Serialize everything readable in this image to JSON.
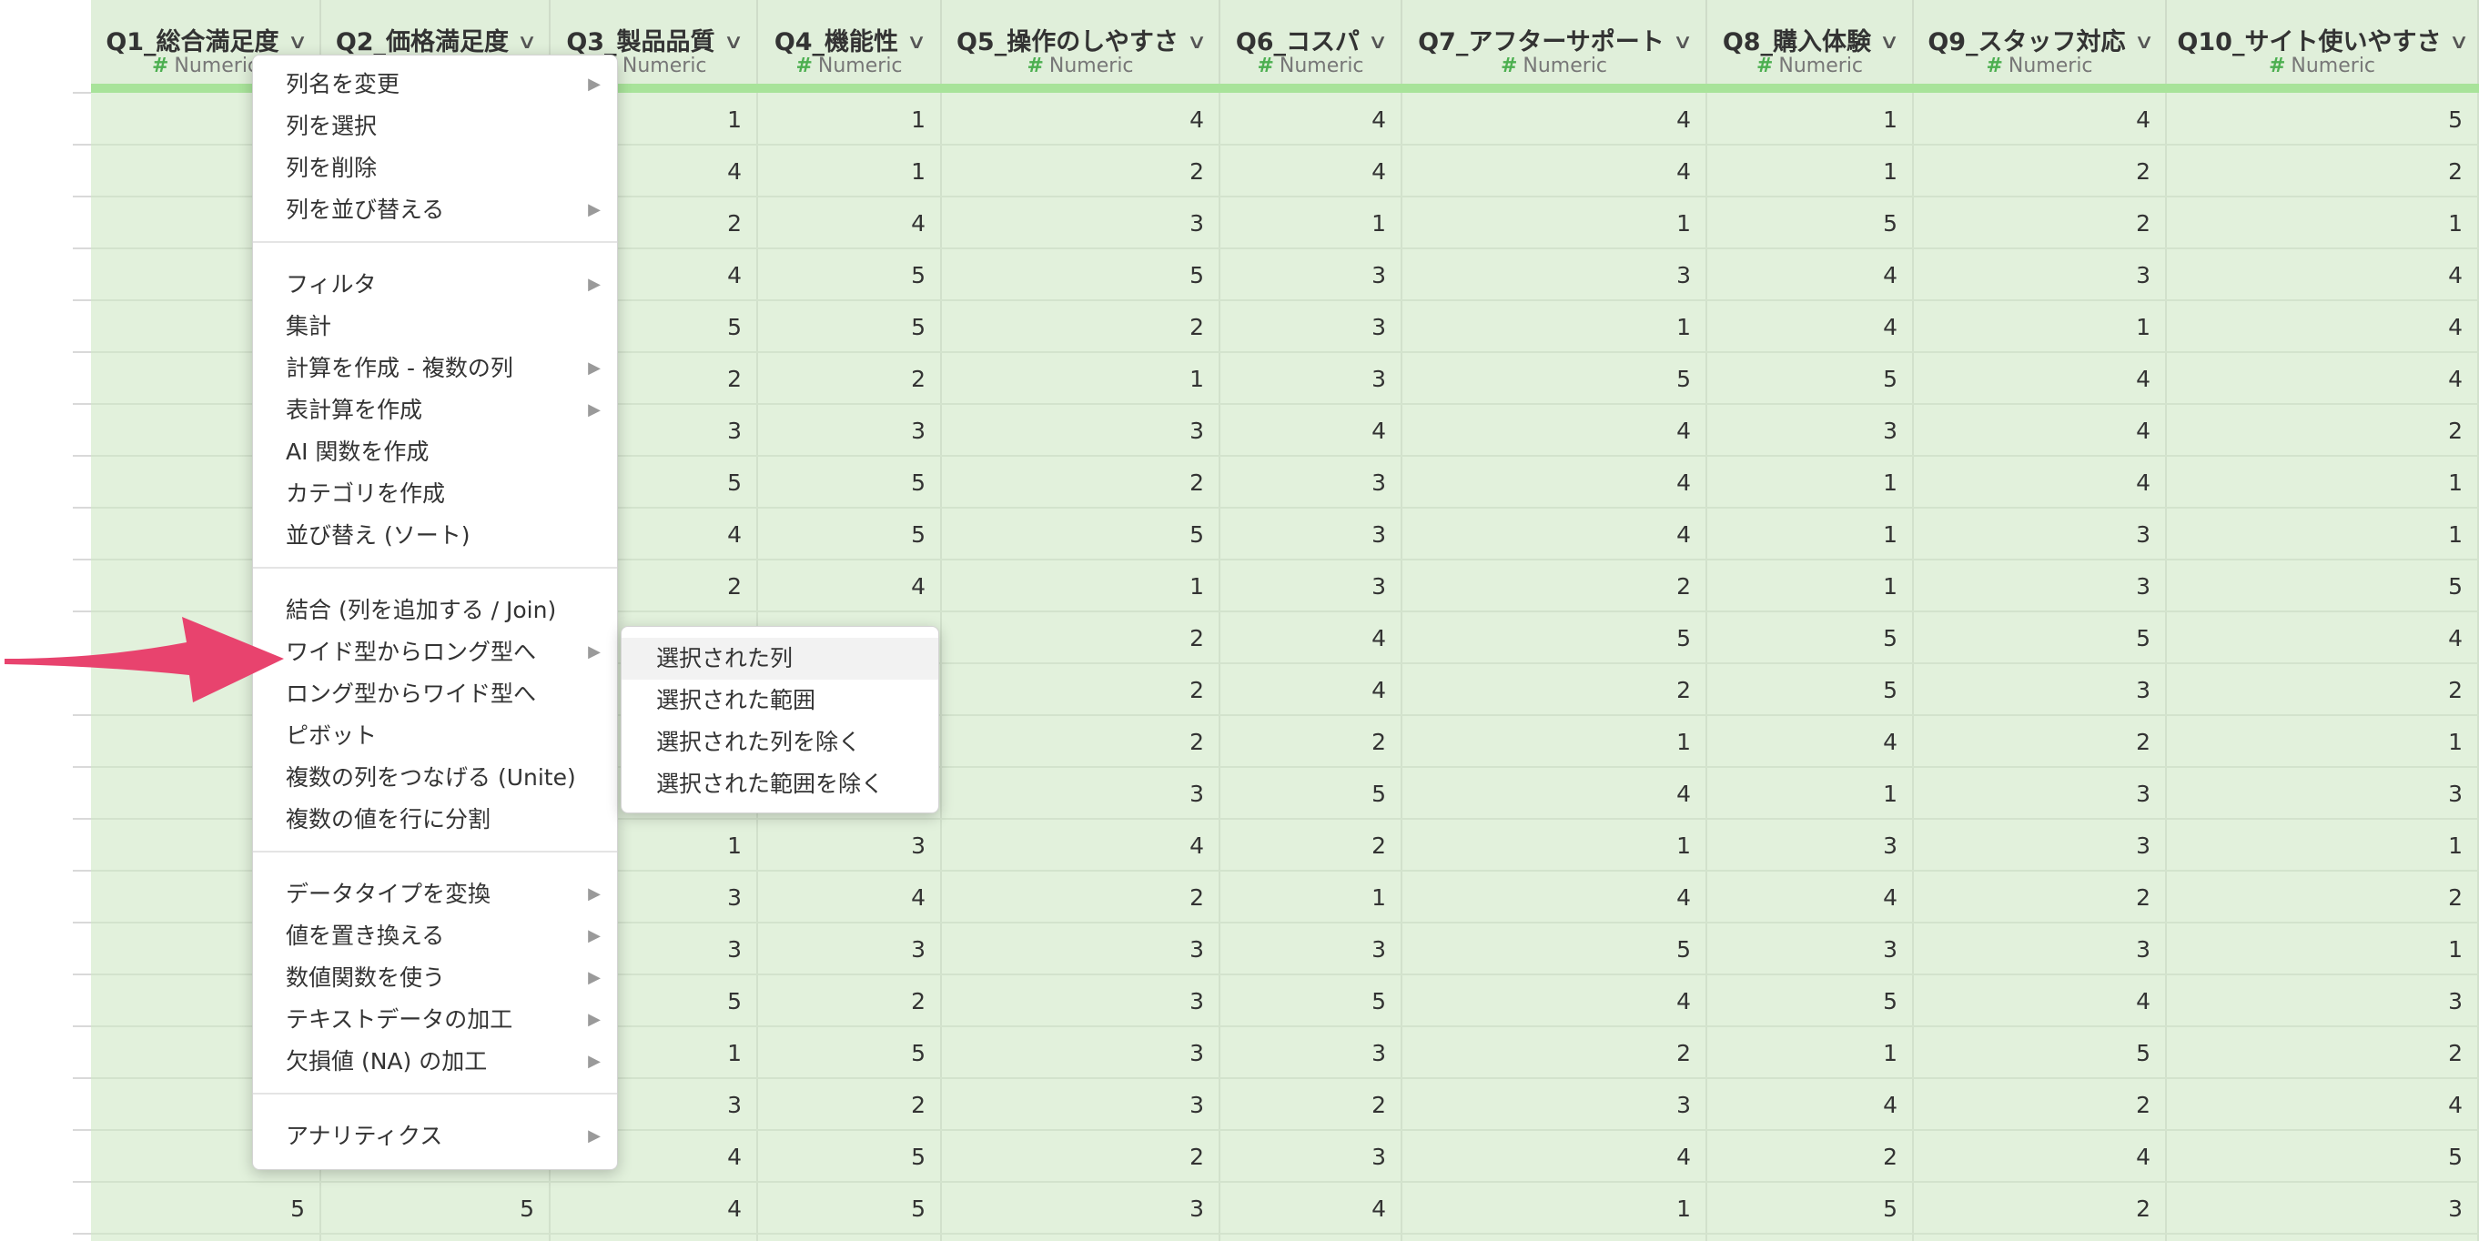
{
  "columns": [
    {
      "name": "Q1_総合満足度",
      "type": "Numeric"
    },
    {
      "name": "Q2_価格満足度",
      "type": "Numeric"
    },
    {
      "name": "Q3_製品品質",
      "type": "Numeric"
    },
    {
      "name": "Q4_機能性",
      "type": "Numeric"
    },
    {
      "name": "Q5_操作のしやすさ",
      "type": "Numeric"
    },
    {
      "name": "Q6_コスパ",
      "type": "Numeric"
    },
    {
      "name": "Q7_アフターサポート",
      "type": "Numeric"
    },
    {
      "name": "Q8_購入体験",
      "type": "Numeric"
    },
    {
      "name": "Q9_スタッフ対応",
      "type": "Numeric"
    },
    {
      "name": "Q10_サイト使いやすさ",
      "type": "Numeric"
    }
  ],
  "type_prefix": "#",
  "rows": [
    [
      "",
      "",
      "1",
      "1",
      "4",
      "4",
      "4",
      "1",
      "4",
      "5"
    ],
    [
      "",
      "",
      "4",
      "1",
      "2",
      "4",
      "4",
      "1",
      "2",
      "2"
    ],
    [
      "",
      "",
      "2",
      "4",
      "3",
      "1",
      "1",
      "5",
      "2",
      "1"
    ],
    [
      "",
      "",
      "4",
      "5",
      "5",
      "3",
      "3",
      "4",
      "3",
      "4"
    ],
    [
      "",
      "",
      "5",
      "5",
      "2",
      "3",
      "1",
      "4",
      "1",
      "4"
    ],
    [
      "",
      "",
      "2",
      "2",
      "1",
      "3",
      "5",
      "5",
      "4",
      "4"
    ],
    [
      "",
      "",
      "3",
      "3",
      "3",
      "4",
      "4",
      "3",
      "4",
      "2"
    ],
    [
      "",
      "",
      "5",
      "5",
      "2",
      "3",
      "4",
      "1",
      "4",
      "1"
    ],
    [
      "",
      "",
      "4",
      "5",
      "5",
      "3",
      "4",
      "1",
      "3",
      "1"
    ],
    [
      "",
      "",
      "2",
      "4",
      "1",
      "3",
      "2",
      "1",
      "3",
      "5"
    ],
    [
      "",
      "",
      "",
      "",
      "2",
      "4",
      "5",
      "5",
      "5",
      "4"
    ],
    [
      "",
      "",
      "",
      "",
      "2",
      "4",
      "2",
      "5",
      "3",
      "2"
    ],
    [
      "",
      "",
      "",
      "",
      "2",
      "2",
      "1",
      "4",
      "2",
      "1"
    ],
    [
      "",
      "",
      "",
      "",
      "3",
      "5",
      "4",
      "1",
      "3",
      "3"
    ],
    [
      "",
      "",
      "1",
      "3",
      "4",
      "2",
      "1",
      "3",
      "3",
      "1"
    ],
    [
      "",
      "",
      "3",
      "4",
      "2",
      "1",
      "4",
      "4",
      "2",
      "2"
    ],
    [
      "",
      "",
      "3",
      "3",
      "3",
      "3",
      "5",
      "3",
      "3",
      "1"
    ],
    [
      "",
      "",
      "5",
      "2",
      "3",
      "5",
      "4",
      "5",
      "4",
      "3"
    ],
    [
      "",
      "",
      "1",
      "5",
      "3",
      "3",
      "2",
      "1",
      "5",
      "2"
    ],
    [
      "",
      "",
      "3",
      "2",
      "3",
      "2",
      "3",
      "4",
      "2",
      "4"
    ],
    [
      "",
      "",
      "4",
      "5",
      "2",
      "3",
      "4",
      "2",
      "4",
      "5"
    ],
    [
      "5",
      "5",
      "4",
      "5",
      "3",
      "4",
      "1",
      "5",
      "2",
      "3"
    ]
  ],
  "context_menu": {
    "groups": [
      [
        {
          "label": "列名を変更",
          "submenu": true
        },
        {
          "label": "列を選択",
          "submenu": false
        },
        {
          "label": "列を削除",
          "submenu": false
        },
        {
          "label": "列を並び替える",
          "submenu": true
        }
      ],
      [
        {
          "label": "フィルタ",
          "submenu": true
        },
        {
          "label": "集計",
          "submenu": false
        },
        {
          "label": "計算を作成 - 複数の列",
          "submenu": true
        },
        {
          "label": "表計算を作成",
          "submenu": true
        },
        {
          "label": "AI 関数を作成",
          "submenu": false
        },
        {
          "label": "カテゴリを作成",
          "submenu": false
        },
        {
          "label": "並び替え (ソート)",
          "submenu": false
        }
      ],
      [
        {
          "label": "結合 (列を追加する / Join)",
          "submenu": false
        },
        {
          "label": "ワイド型からロング型へ",
          "submenu": true
        },
        {
          "label": "ロング型からワイド型へ",
          "submenu": false
        },
        {
          "label": "ピボット",
          "submenu": false
        },
        {
          "label": "複数の列をつなげる (Unite)",
          "submenu": false
        },
        {
          "label": "複数の値を行に分割",
          "submenu": false
        }
      ],
      [
        {
          "label": "データタイプを変換",
          "submenu": true
        },
        {
          "label": "値を置き換える",
          "submenu": true
        },
        {
          "label": "数値関数を使う",
          "submenu": true
        },
        {
          "label": "テキストデータの加工",
          "submenu": true
        },
        {
          "label": "欠損値 (NA) の加工",
          "submenu": true
        }
      ],
      [
        {
          "label": "アナリティクス",
          "submenu": true
        }
      ]
    ]
  },
  "submenu": {
    "items": [
      "選択された列",
      "選択された範囲",
      "選択された列を除く",
      "選択された範囲を除く"
    ],
    "highlighted_index": 0
  },
  "colors": {
    "pointer_arrow": "#e8436e",
    "column_bg": "#e2f1dc",
    "header_accent": "#a8e39a"
  }
}
